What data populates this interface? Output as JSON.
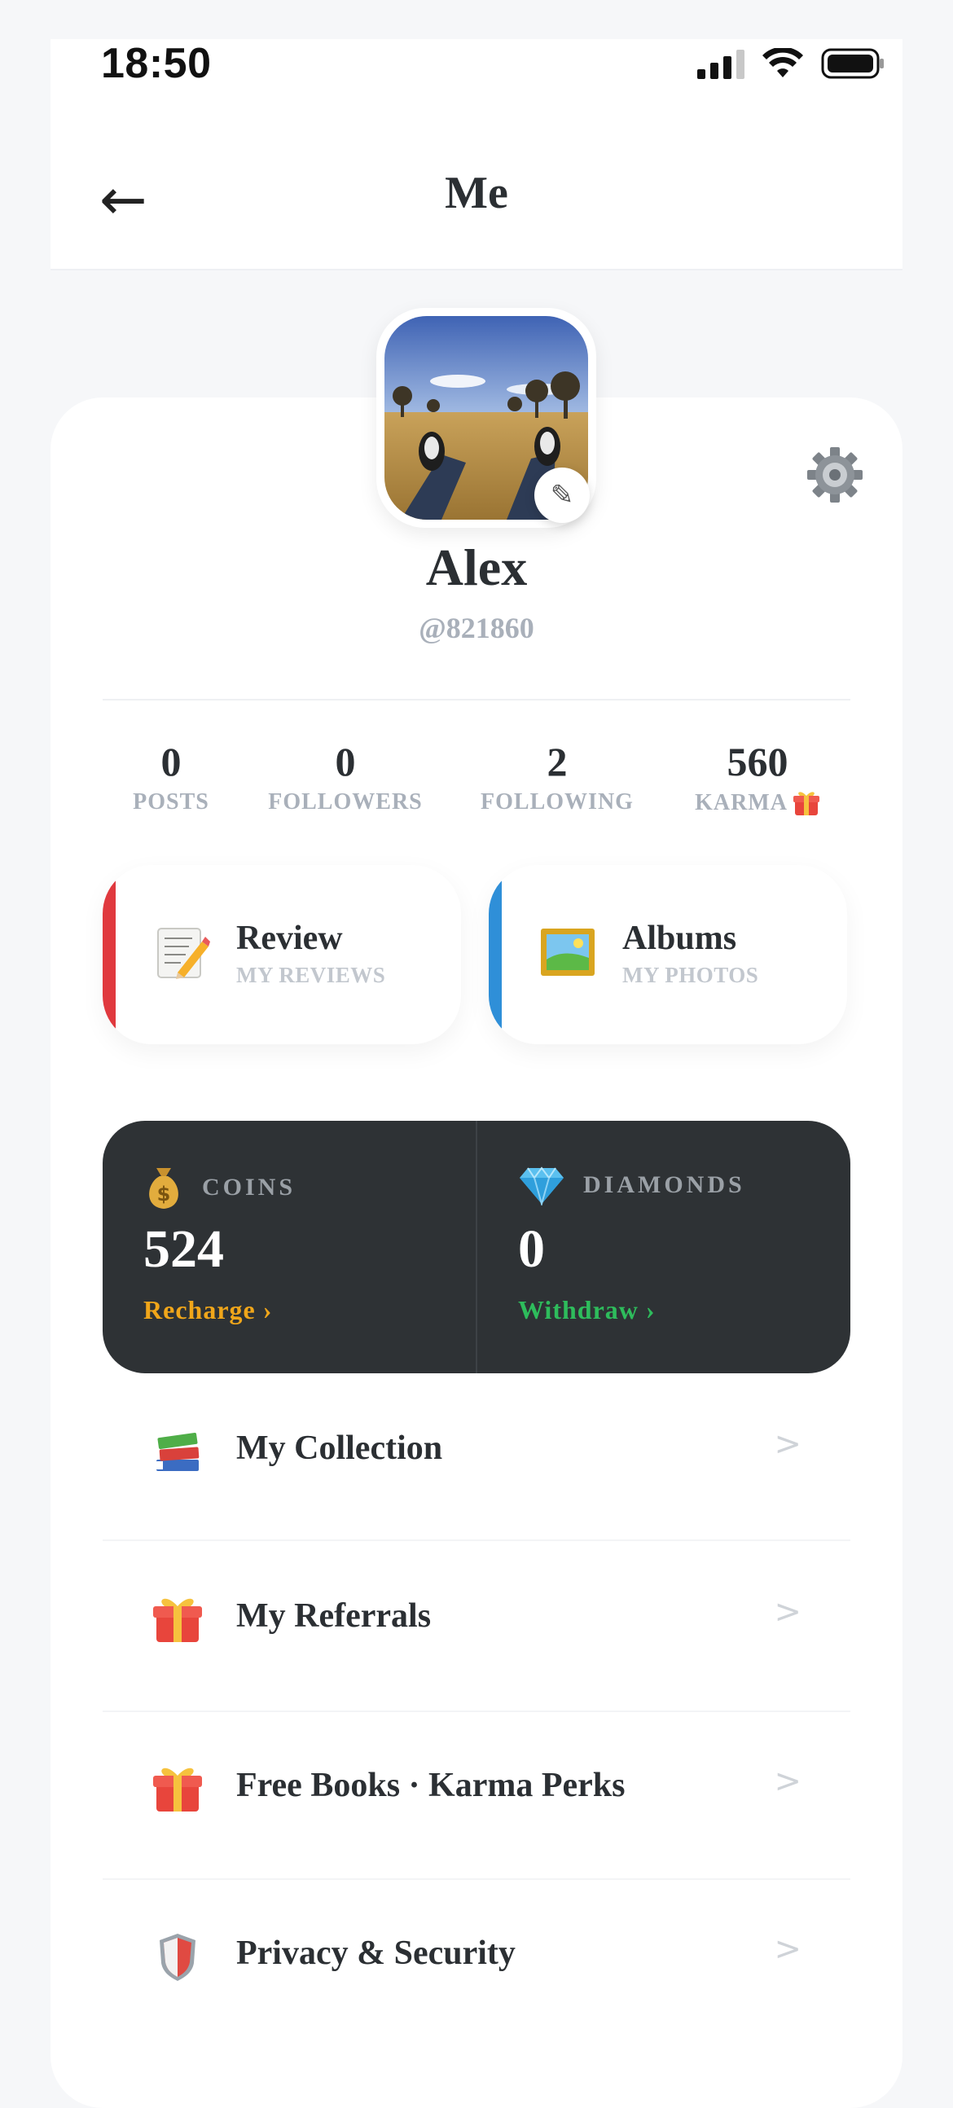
{
  "status_bar": {
    "time": "18:50"
  },
  "header": {
    "back_icon": "back-arrow-icon",
    "title": "Me"
  },
  "profile": {
    "name": "Alex",
    "handle": "@821860",
    "avatar_desc": "landscape-photo",
    "edit_icon": "pencil-icon",
    "settings_icon": "gear-icon"
  },
  "stats": [
    {
      "value": "0",
      "label": "POSTS"
    },
    {
      "value": "0",
      "label": "FOLLOWERS"
    },
    {
      "value": "2",
      "label": "FOLLOWING"
    },
    {
      "value": "560",
      "label": "KARMA",
      "icon": "gift-icon"
    }
  ],
  "tiles": [
    {
      "title": "Review",
      "subtitle": "MY REVIEWS",
      "icon": "memo-icon",
      "accent": "#e0393e"
    },
    {
      "title": "Albums",
      "subtitle": "MY PHOTOS",
      "icon": "framed-picture-icon",
      "accent": "#2f8fd8"
    }
  ],
  "wallet": {
    "coins": {
      "label": "COINS",
      "value": "524",
      "link": "Recharge ›",
      "link_color": "#f0a61a",
      "icon": "money-bag-icon"
    },
    "diamonds": {
      "label": "DIAMONDS",
      "value": "0",
      "link": "Withdraw ›",
      "link_color": "#2ebc5c",
      "icon": "diamond-icon"
    }
  },
  "menu": [
    {
      "label": "My Collection",
      "icon": "books-icon",
      "chevron": ">"
    },
    {
      "label": "My Referrals",
      "icon": "gift-icon",
      "chevron": ">"
    },
    {
      "label": "Free Books · Karma Perks",
      "icon": "gift-icon",
      "chevron": ">"
    },
    {
      "label": "Privacy & Security",
      "icon": "shield-icon",
      "chevron": ">"
    }
  ]
}
